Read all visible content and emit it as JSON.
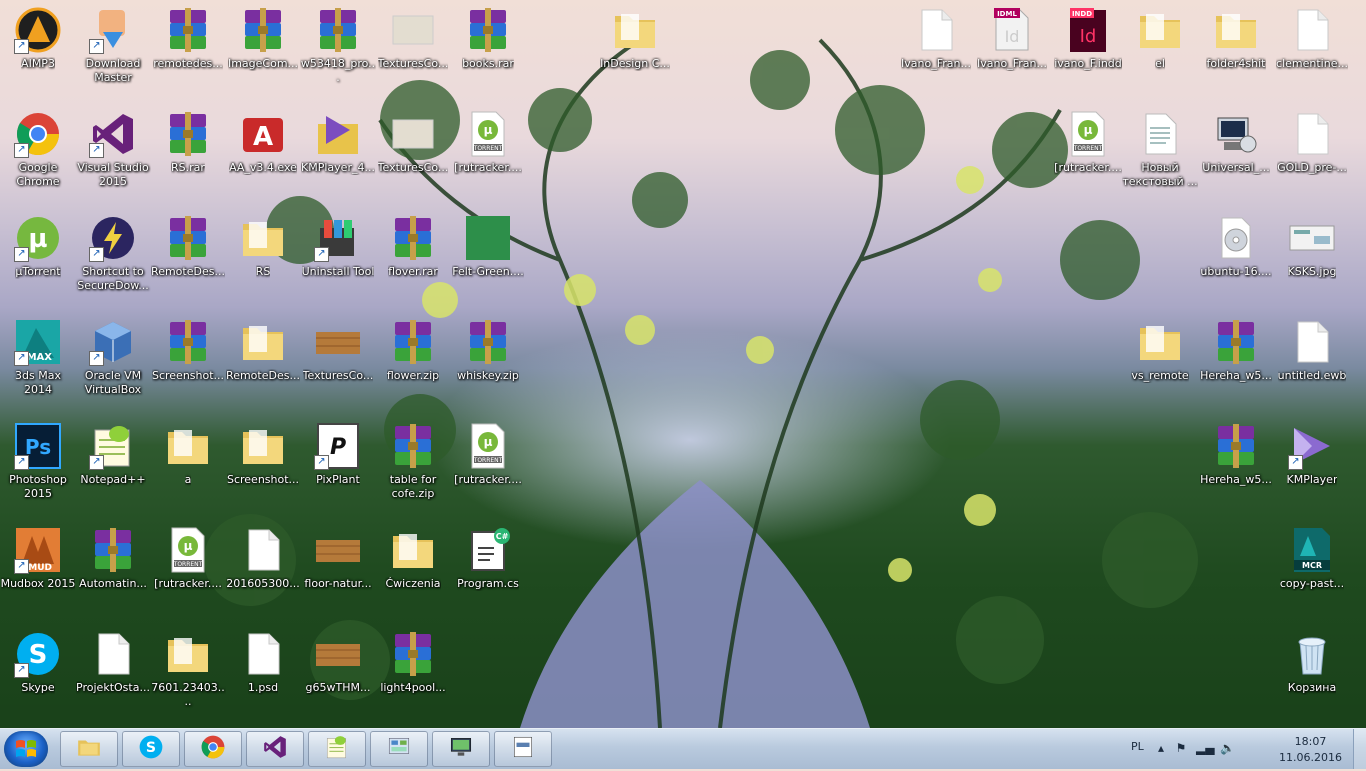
{
  "desktop": {
    "icons": [
      {
        "label": "AIMP3",
        "icon": "aimp-icon",
        "shortcut": true,
        "col": 0,
        "row": 0
      },
      {
        "label": "Download Master",
        "icon": "download-master-icon",
        "shortcut": true,
        "col": 1,
        "row": 0
      },
      {
        "label": "remotedes...",
        "icon": "winrar-icon",
        "shortcut": false,
        "col": 2,
        "row": 0
      },
      {
        "label": "ImageCom...",
        "icon": "winrar-icon",
        "shortcut": false,
        "col": 3,
        "row": 0
      },
      {
        "label": "w53418_pro...",
        "icon": "winrar-icon",
        "shortcut": false,
        "col": 4,
        "row": 0
      },
      {
        "label": "TexturesCo...",
        "icon": "texture-image-icon",
        "shortcut": false,
        "col": 5,
        "row": 0
      },
      {
        "label": "books.rar",
        "icon": "winrar-icon",
        "shortcut": false,
        "col": 6,
        "row": 0
      },
      {
        "label": "InDesign C...",
        "icon": "folder-icon",
        "shortcut": false,
        "col": 8,
        "row": 0
      },
      {
        "label": "Ivano_Fran...",
        "icon": "blank-document-icon",
        "shortcut": false,
        "col": 12,
        "row": 0
      },
      {
        "label": "Ivano_Fran...",
        "icon": "idml-file-icon",
        "shortcut": false,
        "col": 13,
        "row": 0
      },
      {
        "label": "ivano_F.indd",
        "icon": "indd-file-icon",
        "shortcut": false,
        "col": 14,
        "row": 0
      },
      {
        "label": "el",
        "icon": "folder-icon",
        "shortcut": false,
        "col": 15,
        "row": 0
      },
      {
        "label": "folder4shit",
        "icon": "folder-icon",
        "shortcut": false,
        "col": 16,
        "row": 0
      },
      {
        "label": "clementine...",
        "icon": "blank-document-icon",
        "shortcut": false,
        "col": 17,
        "row": 0
      },
      {
        "label": "Google Chrome",
        "icon": "chrome-icon",
        "shortcut": true,
        "col": 0,
        "row": 1
      },
      {
        "label": "Visual Studio 2015",
        "icon": "visual-studio-icon",
        "shortcut": true,
        "col": 1,
        "row": 1
      },
      {
        "label": "RS.rar",
        "icon": "winrar-icon",
        "shortcut": false,
        "col": 2,
        "row": 1
      },
      {
        "label": "AA_v3.4.exe",
        "icon": "ammyy-admin-icon",
        "shortcut": false,
        "col": 3,
        "row": 1
      },
      {
        "label": "KMPlayer_4...",
        "icon": "kmplayer-installer-icon",
        "shortcut": false,
        "col": 4,
        "row": 1
      },
      {
        "label": "TexturesCo...",
        "icon": "texture-image-icon",
        "shortcut": false,
        "col": 5,
        "row": 1
      },
      {
        "label": "[rutracker....",
        "icon": "torrent-file-icon",
        "shortcut": false,
        "col": 6,
        "row": 1
      },
      {
        "label": "[rutracker....",
        "icon": "torrent-file-icon",
        "shortcut": false,
        "col": 14,
        "row": 1
      },
      {
        "label": "Новый текстовый ...",
        "icon": "text-document-icon",
        "shortcut": false,
        "col": 15,
        "row": 1
      },
      {
        "label": "Universal_...",
        "icon": "universal-installer-icon",
        "shortcut": false,
        "col": 16,
        "row": 1
      },
      {
        "label": "GOLD_pre-...",
        "icon": "blank-document-icon",
        "shortcut": false,
        "col": 17,
        "row": 1
      },
      {
        "label": "µTorrent",
        "icon": "utorrent-icon",
        "shortcut": true,
        "col": 0,
        "row": 2
      },
      {
        "label": "Shortcut to SecureDow...",
        "icon": "securedownload-icon",
        "shortcut": true,
        "col": 1,
        "row": 2
      },
      {
        "label": "RemoteDes...",
        "icon": "winrar-icon",
        "shortcut": false,
        "col": 2,
        "row": 2
      },
      {
        "label": "RS",
        "icon": "folder-icon",
        "shortcut": false,
        "col": 3,
        "row": 2
      },
      {
        "label": "Uninstall Tool",
        "icon": "uninstall-tool-icon",
        "shortcut": true,
        "col": 4,
        "row": 2
      },
      {
        "label": "flover.rar",
        "icon": "winrar-icon",
        "shortcut": false,
        "col": 5,
        "row": 2
      },
      {
        "label": "Felt-Green....",
        "icon": "green-texture-icon",
        "shortcut": false,
        "col": 6,
        "row": 2
      },
      {
        "label": "ubuntu-16....",
        "icon": "iso-disc-icon",
        "shortcut": false,
        "col": 16,
        "row": 2
      },
      {
        "label": "KSKS.jpg",
        "icon": "jpg-image-icon",
        "shortcut": false,
        "col": 17,
        "row": 2
      },
      {
        "label": "3ds Max 2014",
        "icon": "3ds-max-icon",
        "shortcut": true,
        "col": 0,
        "row": 3
      },
      {
        "label": "Oracle VM VirtualBox",
        "icon": "virtualbox-icon",
        "shortcut": true,
        "col": 1,
        "row": 3
      },
      {
        "label": "Screenshot...",
        "icon": "winrar-icon",
        "shortcut": false,
        "col": 2,
        "row": 3
      },
      {
        "label": "RemoteDes...",
        "icon": "folder-icon",
        "shortcut": false,
        "col": 3,
        "row": 3
      },
      {
        "label": "TexturesCo...",
        "icon": "wood-texture-icon",
        "shortcut": false,
        "col": 4,
        "row": 3
      },
      {
        "label": "flower.zip",
        "icon": "winrar-icon",
        "shortcut": false,
        "col": 5,
        "row": 3
      },
      {
        "label": "whiskey.zip",
        "icon": "winrar-icon",
        "shortcut": false,
        "col": 6,
        "row": 3
      },
      {
        "label": "vs_remote",
        "icon": "folder-icon",
        "shortcut": false,
        "col": 15,
        "row": 3
      },
      {
        "label": "Hereha_w5...",
        "icon": "winrar-icon",
        "shortcut": false,
        "col": 16,
        "row": 3
      },
      {
        "label": "untitled.ewb",
        "icon": "blank-document-icon",
        "shortcut": false,
        "col": 17,
        "row": 3
      },
      {
        "label": "Photoshop 2015",
        "icon": "photoshop-icon",
        "shortcut": true,
        "col": 0,
        "row": 4
      },
      {
        "label": "Notepad++",
        "icon": "notepad-plus-plus-icon",
        "shortcut": true,
        "col": 1,
        "row": 4
      },
      {
        "label": "a",
        "icon": "folder-icon",
        "shortcut": false,
        "col": 2,
        "row": 4
      },
      {
        "label": "Screenshot...",
        "icon": "folder-icon",
        "shortcut": false,
        "col": 3,
        "row": 4
      },
      {
        "label": "PixPlant",
        "icon": "pixplant-icon",
        "shortcut": true,
        "col": 4,
        "row": 4
      },
      {
        "label": "table for cofe.zip",
        "icon": "winrar-icon",
        "shortcut": false,
        "col": 5,
        "row": 4
      },
      {
        "label": "[rutracker....",
        "icon": "torrent-file-icon",
        "shortcut": false,
        "col": 6,
        "row": 4
      },
      {
        "label": "Hereha_w5...",
        "icon": "winrar-icon",
        "shortcut": false,
        "col": 16,
        "row": 4
      },
      {
        "label": "KMPlayer",
        "icon": "kmplayer-icon",
        "shortcut": true,
        "col": 17,
        "row": 4
      },
      {
        "label": "Mudbox 2015",
        "icon": "mudbox-icon",
        "shortcut": true,
        "col": 0,
        "row": 5
      },
      {
        "label": "Automatin...",
        "icon": "winrar-icon",
        "shortcut": false,
        "col": 1,
        "row": 5
      },
      {
        "label": "[rutracker....",
        "icon": "torrent-file-icon",
        "shortcut": false,
        "col": 2,
        "row": 5
      },
      {
        "label": "201605300...",
        "icon": "blank-document-icon",
        "shortcut": false,
        "col": 3,
        "row": 5
      },
      {
        "label": "floor-natur...",
        "icon": "wood-texture-icon",
        "shortcut": false,
        "col": 4,
        "row": 5
      },
      {
        "label": "Ćwiczenia",
        "icon": "folder-icon",
        "shortcut": false,
        "col": 5,
        "row": 5
      },
      {
        "label": "Program.cs",
        "icon": "csharp-file-icon",
        "shortcut": false,
        "col": 6,
        "row": 5
      },
      {
        "label": "copy-past...",
        "icon": "mcr-file-icon",
        "shortcut": false,
        "col": 17,
        "row": 5
      },
      {
        "label": "Skype",
        "icon": "skype-icon",
        "shortcut": true,
        "col": 0,
        "row": 6
      },
      {
        "label": "ProjektOsta...",
        "icon": "blank-document-icon",
        "shortcut": false,
        "col": 1,
        "row": 6
      },
      {
        "label": "7601.23403....",
        "icon": "folder-icon",
        "shortcut": false,
        "col": 2,
        "row": 6
      },
      {
        "label": "1.psd",
        "icon": "blank-document-icon",
        "shortcut": false,
        "col": 3,
        "row": 6
      },
      {
        "label": "g65wTHM...",
        "icon": "wood-texture-icon",
        "shortcut": false,
        "col": 4,
        "row": 6
      },
      {
        "label": "light4pool...",
        "icon": "winrar-icon",
        "shortcut": false,
        "col": 5,
        "row": 6
      },
      {
        "label": "Корзина",
        "icon": "recycle-bin-icon",
        "shortcut": false,
        "col": 17,
        "row": 6
      }
    ]
  },
  "taskbar": {
    "start_icon": "windows-start-icon",
    "pinned": [
      {
        "name": "explorer",
        "icon": "folder-library-icon"
      },
      {
        "name": "skype",
        "icon": "skype-icon"
      },
      {
        "name": "chrome",
        "icon": "chrome-icon"
      },
      {
        "name": "visual-studio",
        "icon": "visual-studio-icon"
      },
      {
        "name": "notepad-plus-plus",
        "icon": "notepad-plus-plus-icon"
      },
      {
        "name": "control-panel",
        "icon": "control-panel-icon"
      },
      {
        "name": "remote-desktop",
        "icon": "remote-desktop-icon"
      },
      {
        "name": "active-window",
        "icon": "app-window-icon"
      }
    ],
    "tray": {
      "language": "PL",
      "time": "18:07",
      "date": "11.06.2016"
    }
  }
}
